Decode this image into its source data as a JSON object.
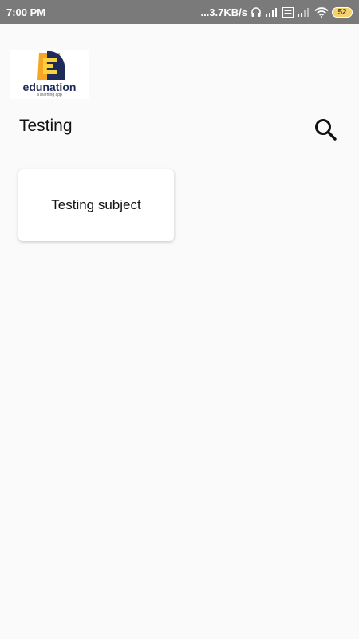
{
  "status_bar": {
    "time": "7:00 PM",
    "net_speed": "...3.7KB/s",
    "battery": "52"
  },
  "logo": {
    "wordmark": "edunation",
    "tagline": "a learning app"
  },
  "header": {
    "title": "Testing"
  },
  "subjects": [
    {
      "label": "Testing subject"
    }
  ],
  "colors": {
    "status_bar_bg": "#7a7a7a",
    "page_bg": "#fafafa",
    "logo_orange": "#f5a623",
    "logo_navy": "#1e2b5a",
    "logo_yellow": "#f7d23e"
  }
}
